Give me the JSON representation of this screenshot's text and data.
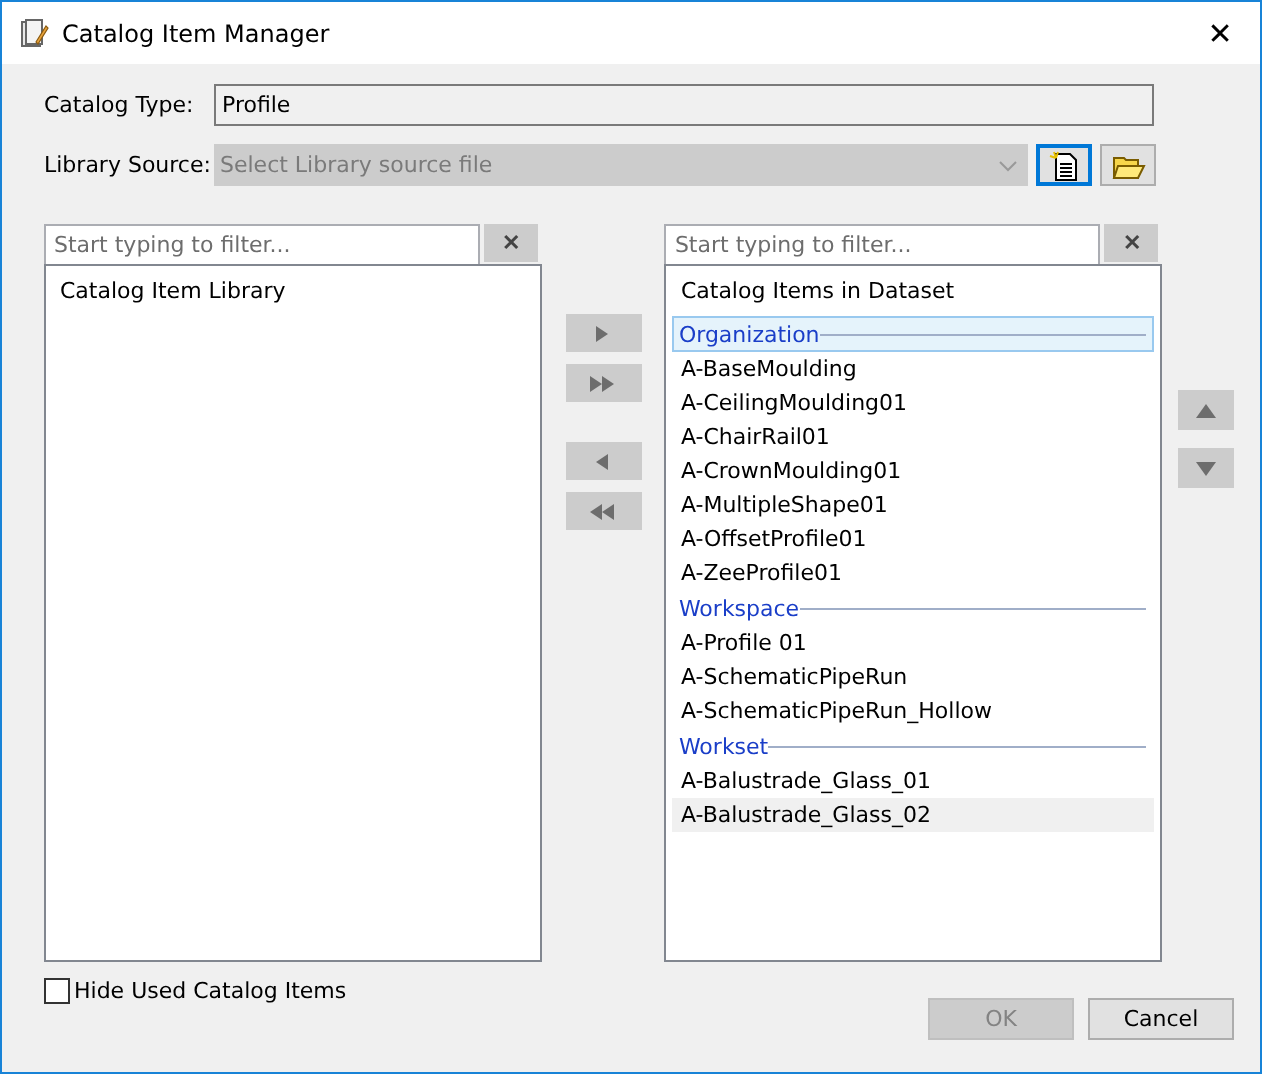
{
  "window": {
    "title": "Catalog Item Manager",
    "close": "✕"
  },
  "catalog_type": {
    "label": "Catalog Type:",
    "value": "Profile"
  },
  "library_source": {
    "label": "Library Source:",
    "placeholder": "Select Library source file",
    "disabled": true
  },
  "left_panel": {
    "filter": {
      "placeholder": "Start typing to filter...",
      "clear": "✕"
    },
    "heading": "Catalog Item Library"
  },
  "transfer_buttons": [
    {
      "kind": "add",
      "disabled": true
    },
    {
      "kind": "add-all",
      "disabled": true
    },
    {
      "kind": "remove",
      "disabled": true
    },
    {
      "kind": "remove-all",
      "disabled": true
    }
  ],
  "right_panel": {
    "filter": {
      "placeholder": "Start typing to filter...",
      "clear": "✕"
    },
    "heading": "Catalog Items in Dataset",
    "groups": [
      {
        "name": "Organization",
        "focused": true,
        "items": [
          {
            "label": "A-BaseMoulding",
            "selected": false
          },
          {
            "label": "A-CeilingMoulding01",
            "selected": false
          },
          {
            "label": "A-ChairRail01",
            "selected": false
          },
          {
            "label": "A-CrownMoulding01",
            "selected": false
          },
          {
            "label": "A-MultipleShape01",
            "selected": false
          },
          {
            "label": "A-OffsetProfile01",
            "selected": false
          },
          {
            "label": "A-ZeeProfile01",
            "selected": false
          }
        ]
      },
      {
        "name": "Workspace",
        "focused": false,
        "items": [
          {
            "label": "A-Profile 01",
            "selected": false
          },
          {
            "label": "A-SchematicPipeRun",
            "selected": false
          },
          {
            "label": "A-SchematicPipeRun_Hollow",
            "selected": false
          }
        ]
      },
      {
        "name": "Workset",
        "focused": false,
        "items": [
          {
            "label": "A-Balustrade_Glass_01",
            "selected": false
          },
          {
            "label": "A-Balustrade_Glass_02",
            "selected": true
          }
        ]
      }
    ]
  },
  "order_buttons": [
    {
      "kind": "up"
    },
    {
      "kind": "down"
    }
  ],
  "hide_used": {
    "label": "Hide Used Catalog Items",
    "checked": false
  },
  "buttons": [
    {
      "label": "OK",
      "disabled": true
    },
    {
      "label": "Cancel",
      "disabled": false
    }
  ]
}
